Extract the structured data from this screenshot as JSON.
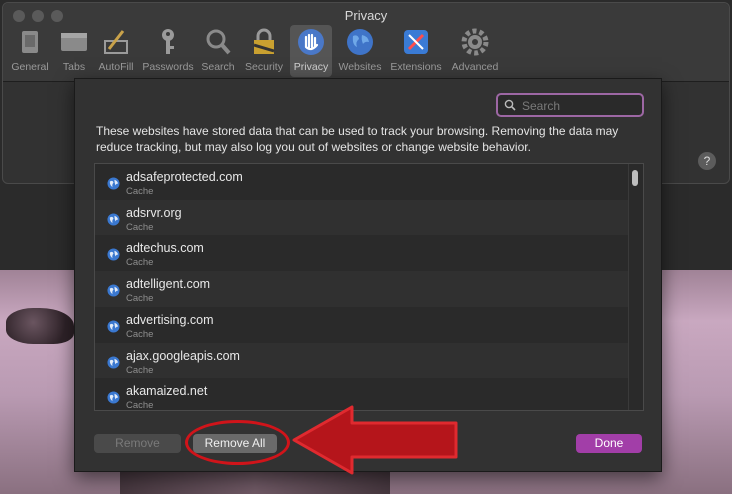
{
  "window": {
    "title": "Privacy"
  },
  "toolbar": [
    {
      "label": "General",
      "icon": "general-icon"
    },
    {
      "label": "Tabs",
      "icon": "tabs-icon"
    },
    {
      "label": "AutoFill",
      "icon": "autofill-icon"
    },
    {
      "label": "Passwords",
      "icon": "key-icon"
    },
    {
      "label": "Search",
      "icon": "magnifier-icon"
    },
    {
      "label": "Security",
      "icon": "padlock-icon"
    },
    {
      "label": "Privacy",
      "icon": "hand-icon",
      "active": true
    },
    {
      "label": "Websites",
      "icon": "globe-icon"
    },
    {
      "label": "Extensions",
      "icon": "extensions-icon"
    },
    {
      "label": "Advanced",
      "icon": "gear-icon"
    }
  ],
  "help": {
    "label": "?"
  },
  "sheet": {
    "search_placeholder": "Search",
    "description": "These websites have stored data that can be used to track your browsing. Removing the data may reduce tracking, but may also log you out of websites or change website behavior.",
    "websites": [
      {
        "name": "adsafeprotected.com",
        "type": "Cache"
      },
      {
        "name": "adsrvr.org",
        "type": "Cache"
      },
      {
        "name": "adtechus.com",
        "type": "Cache"
      },
      {
        "name": "adtelligent.com",
        "type": "Cache"
      },
      {
        "name": "advertising.com",
        "type": "Cache"
      },
      {
        "name": "ajax.googleapis.com",
        "type": "Cache"
      },
      {
        "name": "akamaized.net",
        "type": "Cache"
      }
    ],
    "remove_label": "Remove",
    "remove_all_label": "Remove All",
    "done_label": "Done"
  },
  "colors": {
    "accent": "#a23ea8",
    "annotation_red": "#d0141a",
    "search_focus": "#9d67a4"
  }
}
